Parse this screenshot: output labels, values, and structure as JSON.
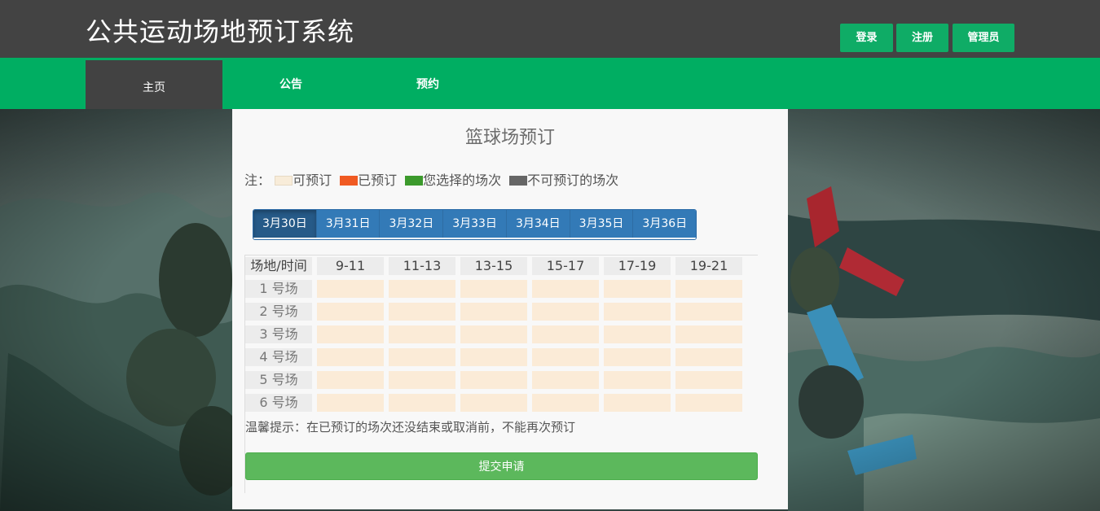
{
  "header": {
    "title": "公共运动场地预订系统",
    "login_label": "登录",
    "register_label": "注册",
    "admin_label": "管理员"
  },
  "nav": {
    "items": [
      {
        "label": "主页"
      },
      {
        "label": "公告"
      },
      {
        "label": "预约"
      }
    ]
  },
  "booking": {
    "title": "篮球场预订",
    "legend": {
      "prefix": "注：",
      "items": [
        {
          "label": "可预订",
          "color": "#f8ecd9"
        },
        {
          "label": "已预订",
          "color": "#f05a22"
        },
        {
          "label": "您选择的场次",
          "color": "#3c9a2c"
        },
        {
          "label": "不可预订的场次",
          "color": "#666666"
        }
      ]
    },
    "dates": [
      "3月30日",
      "3月31日",
      "3月32日",
      "3月33日",
      "3月34日",
      "3月35日",
      "3月36日"
    ],
    "table": {
      "corner": "场地/时间",
      "times": [
        "9-11",
        "11-13",
        "13-15",
        "15-17",
        "17-19",
        "19-21"
      ],
      "courts": [
        "1 号场",
        "2 号场",
        "3 号场",
        "4 号场",
        "5 号场",
        "6 号场"
      ]
    },
    "tip": "温馨提示：在已预订的场次还没结束或取消前，不能再次预订",
    "submit_label": "提交申请"
  }
}
